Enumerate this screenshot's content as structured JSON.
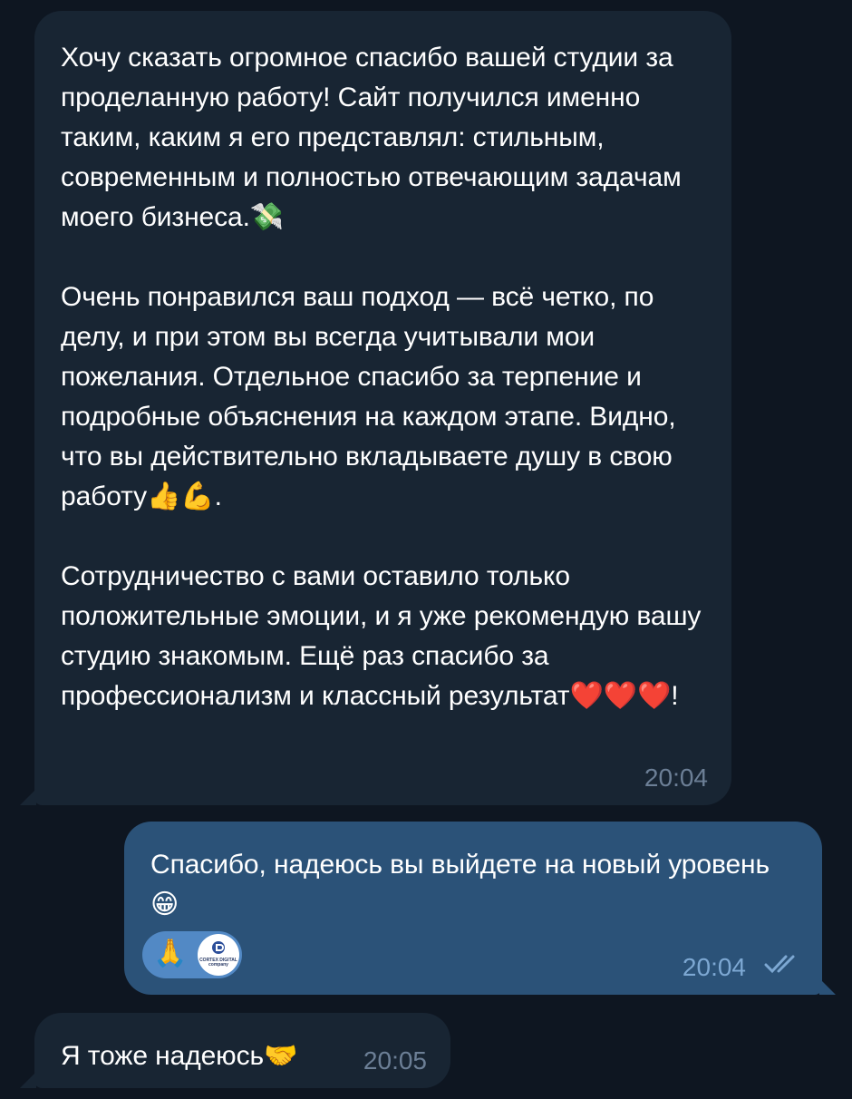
{
  "messages": [
    {
      "direction": "incoming",
      "paragraphs": [
        {
          "text": "Хочу сказать огромное спасибо вашей студии за проделанную работу! Сайт получился именно таким, каким я его представлял: стильным, современным и полностью отвечающим задачам моего бизнеса.",
          "emoji": "💸"
        },
        {
          "text": "Очень понравился ваш подход — всё четко, по делу, и при этом вы всегда учитывали мои пожелания. Отдельное спасибо за терпение и подробные объяснения на каждом этапе. Видно, что вы действительно вкладываете душу в свою работу",
          "emoji": "👍💪",
          "tail": "."
        },
        {
          "text": "Сотрудничество с вами оставило только положительные эмоции, и я уже рекомендую вашу студию знакомым. Ещё раз спасибо за профессионализм и классный результат",
          "emoji": "❤️❤️❤️",
          "tail": "!"
        }
      ],
      "time": "20:04"
    },
    {
      "direction": "outgoing",
      "paragraphs": [
        {
          "text": "Спасибо, надеюсь вы выйдете на новый уровень ",
          "emoji": "😁"
        }
      ],
      "reaction": {
        "emoji": "🙏",
        "avatar_text": "CORTEX DIGITAL company"
      },
      "time": "20:04",
      "status": "read-double-check-icon"
    },
    {
      "direction": "incoming",
      "paragraphs": [
        {
          "text": "Я тоже надеюсь",
          "emoji": "🤝"
        }
      ],
      "time": "20:05"
    }
  ],
  "colors": {
    "background": "#0e1621",
    "incoming_bubble": "#182533",
    "outgoing_bubble": "#2b5278",
    "reaction_pill": "#5289c5",
    "time_incoming": "#6c7f96",
    "time_outgoing": "#7da8d3"
  }
}
